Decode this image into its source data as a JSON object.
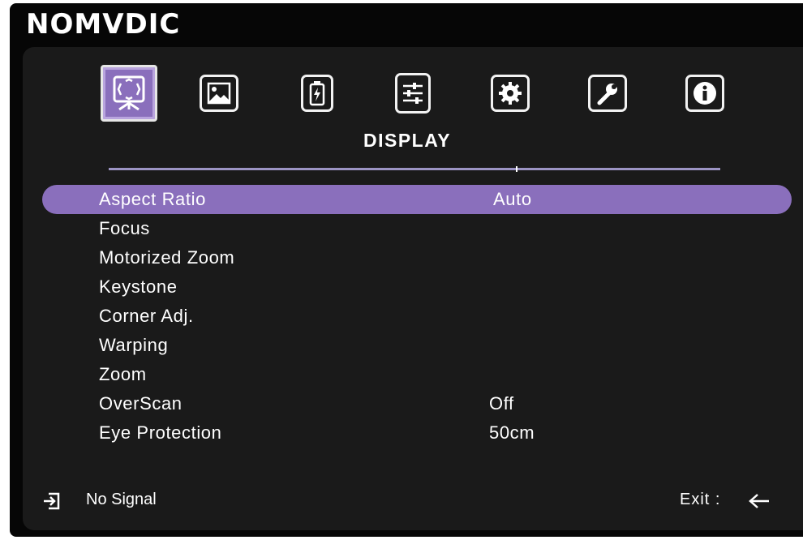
{
  "brand": "NOMVDIC",
  "colors": {
    "accent": "#8a6fbc",
    "panel": "#1a1a1a",
    "frame": "#060606",
    "underline": "#9c94c4"
  },
  "tabs": [
    {
      "name": "display",
      "icon": "display-screen-icon",
      "active": true
    },
    {
      "name": "picture",
      "icon": "image-icon",
      "active": false
    },
    {
      "name": "power",
      "icon": "battery-icon",
      "active": false
    },
    {
      "name": "basic",
      "icon": "sliders-icon",
      "active": false
    },
    {
      "name": "advanced",
      "icon": "gear-icon",
      "active": false
    },
    {
      "name": "system",
      "icon": "wrench-icon",
      "active": false
    },
    {
      "name": "information",
      "icon": "info-icon",
      "active": false
    }
  ],
  "active_tab_title": "DISPLAY",
  "menu": [
    {
      "label": "Aspect Ratio",
      "value": "Auto"
    },
    {
      "label": "Focus",
      "value": ""
    },
    {
      "label": "Motorized Zoom",
      "value": ""
    },
    {
      "label": "Keystone",
      "value": ""
    },
    {
      "label": "Corner Adj.",
      "value": ""
    },
    {
      "label": "Warping",
      "value": ""
    },
    {
      "label": "Zoom",
      "value": ""
    },
    {
      "label": "OverScan",
      "value": "Off"
    },
    {
      "label": "Eye Protection",
      "value": "50cm"
    }
  ],
  "footer": {
    "signal_icon": "input-source-icon",
    "signal_text": "No Signal",
    "exit_label": "Exit :",
    "exit_icon": "back-arrow-icon"
  }
}
